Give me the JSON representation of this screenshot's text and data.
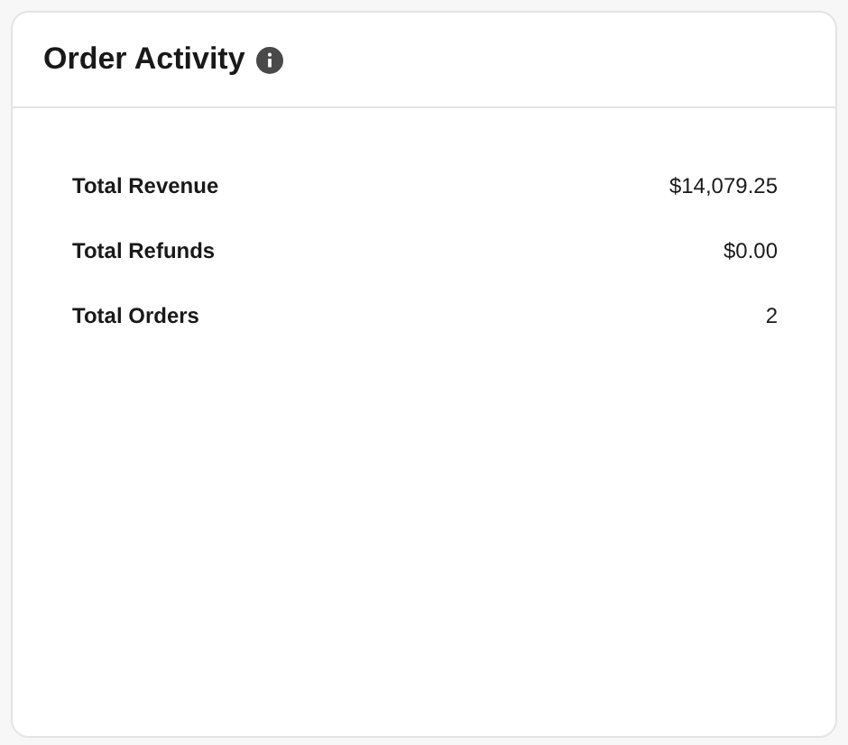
{
  "card": {
    "title": "Order Activity"
  },
  "metrics": [
    {
      "label": "Total Revenue",
      "value": "$14,079.25"
    },
    {
      "label": "Total Refunds",
      "value": "$0.00"
    },
    {
      "label": "Total Orders",
      "value": "2"
    }
  ]
}
